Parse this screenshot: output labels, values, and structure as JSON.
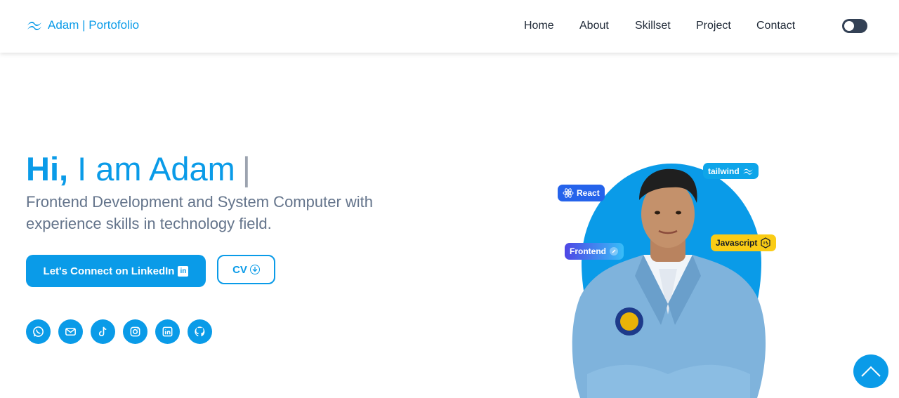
{
  "brand": {
    "label": "Adam | Portofolio"
  },
  "nav": {
    "items": [
      {
        "label": "Home"
      },
      {
        "label": "About"
      },
      {
        "label": "Skillset"
      },
      {
        "label": "Project"
      },
      {
        "label": "Contact"
      }
    ]
  },
  "theme_toggle": {
    "state": "dark-off",
    "icon": "toggle-icon"
  },
  "hero": {
    "greeting_bold": "Hi,",
    "greeting_rest": "I am Adam",
    "caret": "|",
    "subtitle": "Frontend Development and System Computer with experience skills in technology field."
  },
  "buttons": {
    "linkedin_label": "Let's Connect on LinkedIn",
    "linkedin_icon_text": "in",
    "cv_label": "CV"
  },
  "socials": [
    {
      "name": "whatsapp-icon"
    },
    {
      "name": "mail-icon"
    },
    {
      "name": "tiktok-icon"
    },
    {
      "name": "instagram-icon"
    },
    {
      "name": "linkedin-icon"
    },
    {
      "name": "github-icon"
    }
  ],
  "skill_chips": {
    "react": "React",
    "tailwind": "tailwind",
    "frontend": "Frontend",
    "javascript": "Javascript"
  },
  "colors": {
    "accent": "#0a9be8",
    "text": "#1f2937",
    "muted": "#64748b"
  }
}
